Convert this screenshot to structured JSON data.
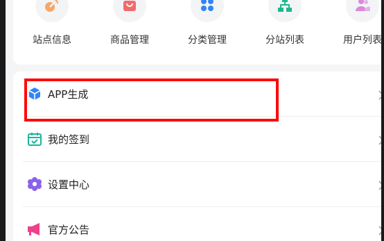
{
  "shortcuts": [
    {
      "label": "站点信息",
      "icon": "satellite-dish-icon",
      "color": "#f5a86a"
    },
    {
      "label": "商品管理",
      "icon": "shopping-bag-icon",
      "color": "#f26b6b"
    },
    {
      "label": "分类管理",
      "icon": "grid-dots-icon",
      "color": "#2f86f6"
    },
    {
      "label": "分站列表",
      "icon": "network-tree-icon",
      "color": "#1bb98e"
    },
    {
      "label": "用户列表",
      "icon": "users-icon",
      "color": "#d88bd8"
    }
  ],
  "menu": [
    {
      "label": "APP生成",
      "icon": "cube-icon",
      "color": "#2f86f6"
    },
    {
      "label": "我的签到",
      "icon": "calendar-check-icon",
      "color": "#17b79a"
    },
    {
      "label": "设置中心",
      "icon": "gear-flower-icon",
      "color": "#8a63e8"
    },
    {
      "label": "官方公告",
      "icon": "megaphone-icon",
      "color": "#f0408a"
    }
  ],
  "chevron": "›",
  "highlight_color": "#ff0a0a"
}
